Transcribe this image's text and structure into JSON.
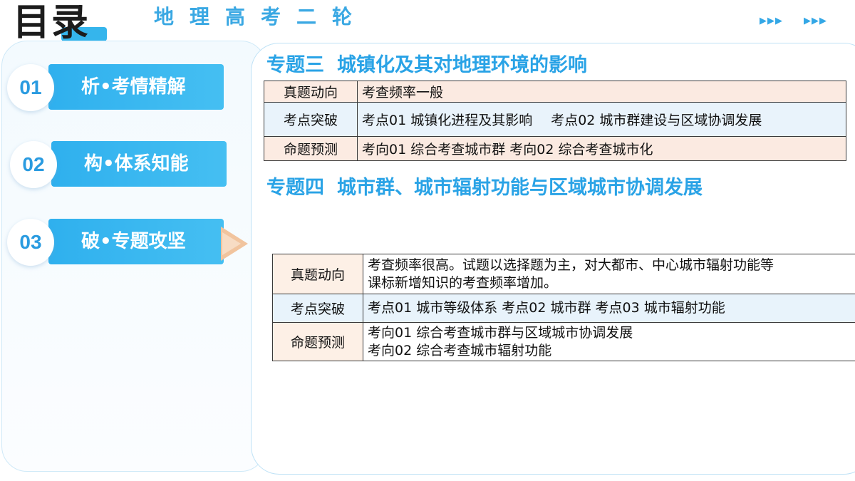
{
  "header": {
    "title": "目录",
    "subtitle": "地理高考二轮",
    "arrows_left": "▶▶▶",
    "arrows_right": "▶▶▶"
  },
  "nav": [
    {
      "num": "01",
      "label": "析•考情精解"
    },
    {
      "num": "02",
      "label": "构•体系知能"
    },
    {
      "num": "03",
      "label": "破•专题攻坚",
      "active": true
    }
  ],
  "topic3": {
    "head": "专题三",
    "title": "城镇化及其对地理环境的影响",
    "rows": [
      {
        "key": "真题动向",
        "value": "考查频率一般"
      },
      {
        "key": "考点突破",
        "value_a": "考点01 城镇化进程及其影响",
        "value_b": "考点02 城市群建设与区域协调发展"
      },
      {
        "key": "命题预测",
        "value": "考向01  综合考查城市群  考向02  综合考查城市化"
      }
    ]
  },
  "topic4": {
    "head": "专题四",
    "title": "城市群、城市辐射功能与区域城市协调发展",
    "rows": [
      {
        "key": "真题动向",
        "line1": "考查频率很高。试题以选择题为主，对大都市、中心城市辐射功能等",
        "line2": "课标新增知识的考查频率增加。"
      },
      {
        "key": "考点突破",
        "value": "考点01 城市等级体系  考点02 城市群  考点03 城市辐射功能"
      },
      {
        "key": "命题预测",
        "line1": "考向01 综合考查城市群与区域城市协调发展",
        "line2": "考向02 综合考查城市辐射功能"
      }
    ]
  },
  "colors": {
    "accent": "#35b5ec",
    "title_blue": "#2aa3e6",
    "pointer": "#f1c49e"
  }
}
